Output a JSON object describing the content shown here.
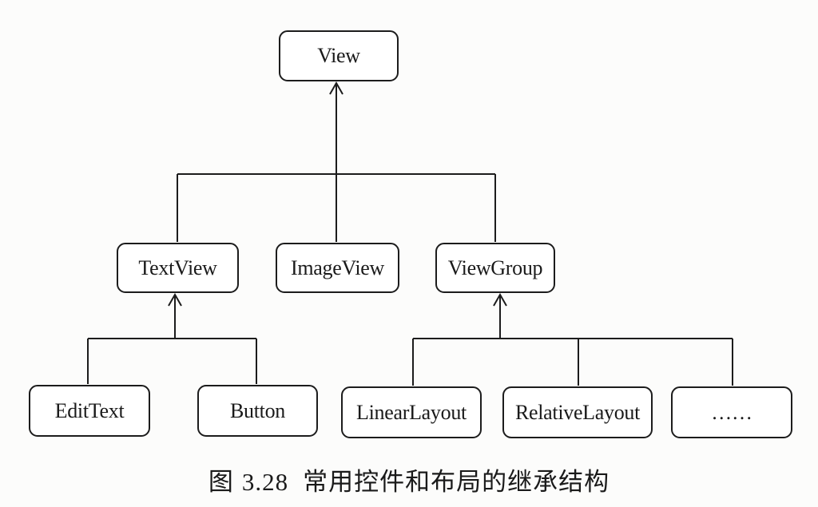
{
  "nodes": {
    "view": "View",
    "textview": "TextView",
    "imageview": "ImageView",
    "viewgroup": "ViewGroup",
    "edittext": "EditText",
    "button": "Button",
    "linearlayout": "LinearLayout",
    "relativelayout": "RelativeLayout",
    "more": "……"
  },
  "caption": {
    "prefix": "图",
    "number": "3.28",
    "title": "常用控件和布局的继承结构"
  },
  "colors": {
    "line": "#1c1c1c",
    "background": "#fcfcfb"
  }
}
